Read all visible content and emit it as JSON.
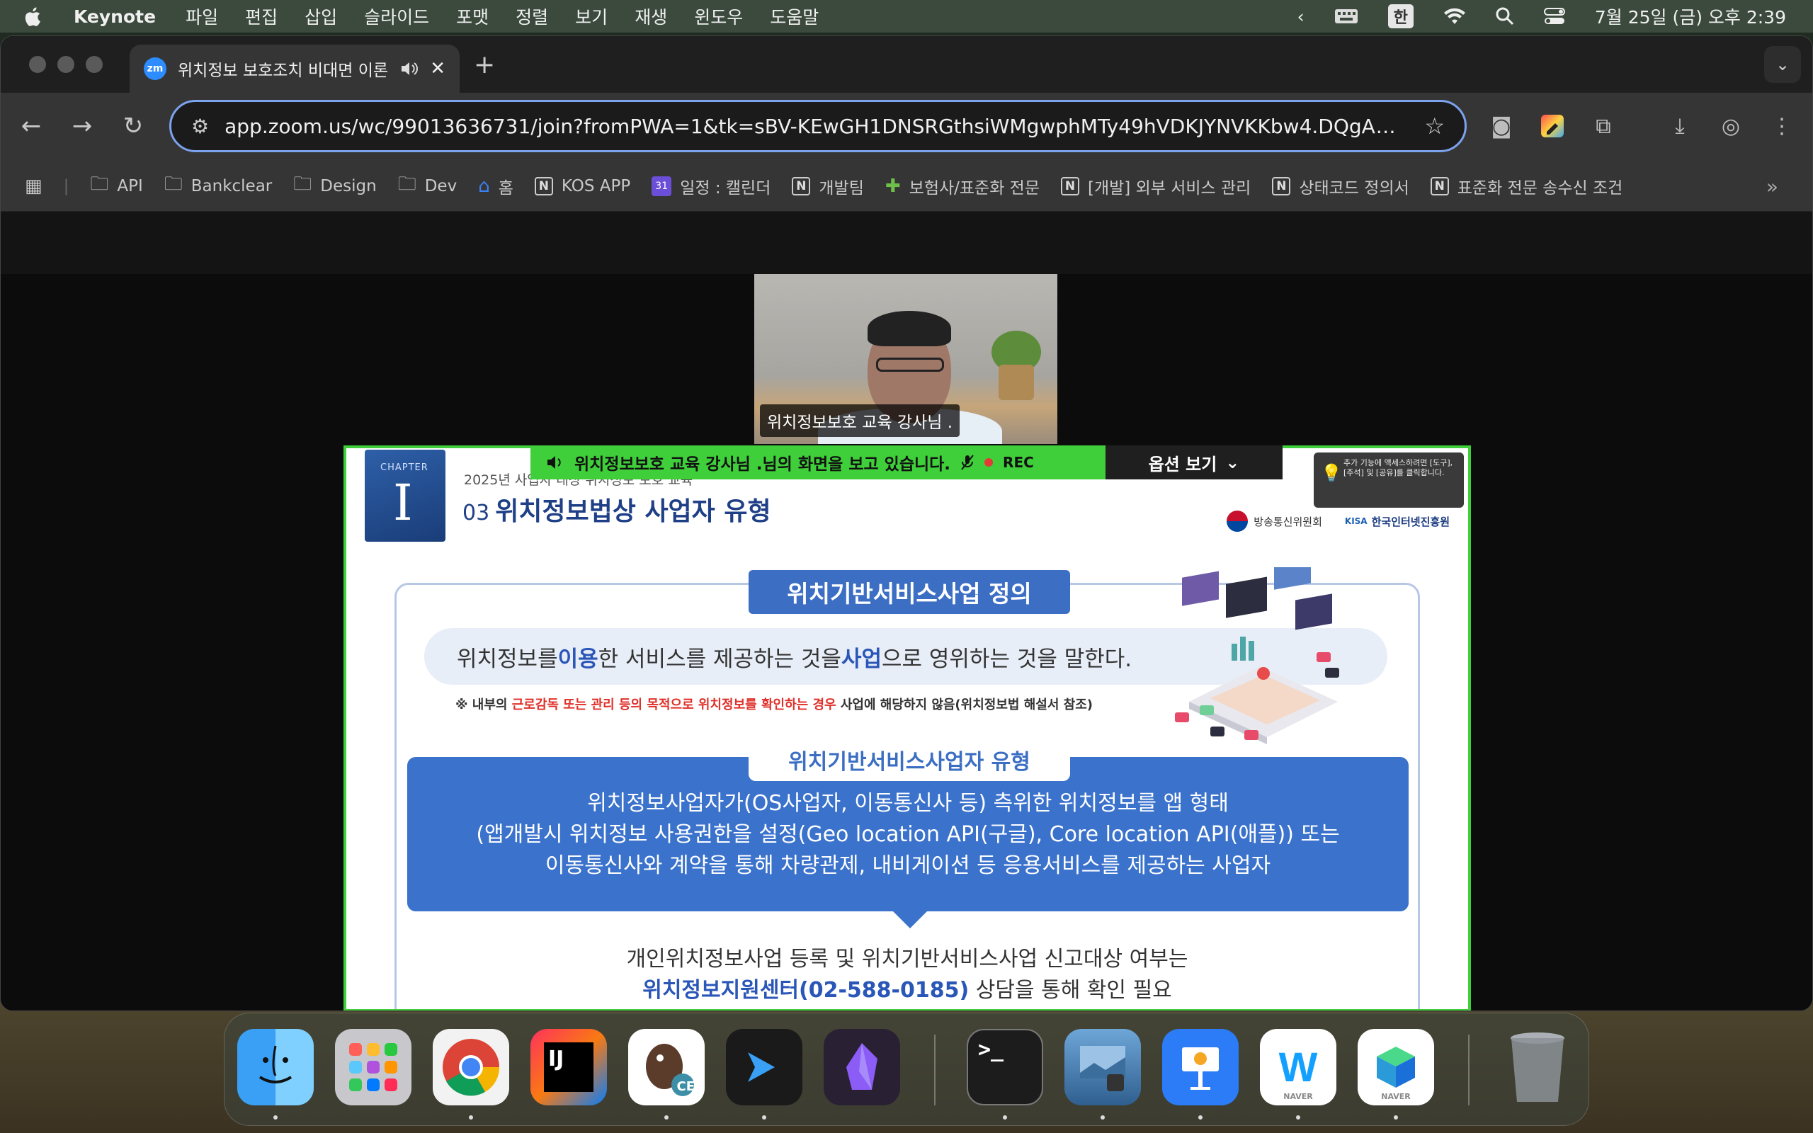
{
  "menubar": {
    "app_name": "Keynote",
    "menus": [
      "파일",
      "편집",
      "삽입",
      "슬라이드",
      "포맷",
      "정렬",
      "보기",
      "재생",
      "윈도우",
      "도움말"
    ],
    "input_source": "한",
    "datetime": "7월 25일 (금) 오후 2:39"
  },
  "browser": {
    "tab": {
      "favicon_text": "zm",
      "title": "위치정보 보호조치 비대면 이론"
    },
    "url": "app.zoom.us/wc/99013636731/join?fromPWA=1&tk=sBV-KEwGH1DNSRGthsiWMgwphMTy49hVDKJYNVKKbw4.DQgAAAAX...",
    "bookmarks": [
      "API",
      "Bankclear",
      "Design",
      "Dev",
      "홈",
      "KOS APP",
      "일정 : 캘린더",
      "개발팀",
      "보험사/표준화 전문",
      "[개발] 외부 서비스 관리",
      "상태코드 정의서",
      "표준화 전문 송수신 조건"
    ],
    "calendar_badge": "31"
  },
  "zoom": {
    "participant_name": "위치정보보호 교육 강사님 .",
    "share_banner": "위치정보보호 교육 강사님 .님의 화면을 보고 있습니다.",
    "rec_label": "REC",
    "options_label": "옵션 보기",
    "tip_text": "추가 기능에 액세스하려면 [도구], [주석] 및 [공유]를 클릭합니다."
  },
  "slide": {
    "chapter_label": "CHAPTER",
    "chapter_num": "I",
    "subtitle": "2025년 사업자 대상 위치정보 보호 교육",
    "title_no": "03",
    "title": "위치정보법상 사업자 유형",
    "logo_kcc": "방송통신위원회",
    "logo_kisa_mark": "KISA",
    "logo_kisa": "한국인터넷진흥원",
    "def_head": "위치기반서비스사업 정의",
    "def_parts": [
      "위치정보를 ",
      "이용",
      "한 서비스를 제공하는 것을 ",
      "사업",
      "으로 영위하는 것을 말한다."
    ],
    "note_parts": [
      "※  내부의 ",
      "근로감독 또는 관리 등의 목적으로 위치정보를 확인하는 경우",
      " 사업에 해당하지 않음(위치정보법 해설서 참조)"
    ],
    "type_head": "위치기반서비스사업자 유형",
    "type_lines": [
      "위치정보사업자가(OS사업자, 이동통신사 등) 측위한 위치정보를 앱 형태",
      "(앱개발시 위치정보 사용권한을 설정(Geo location API(구글), Core location API(애플)) 또는",
      "이동통신사와 계약을 통해 차량관제, 내비게이션 등 응용서비스를 제공하는 사업자"
    ],
    "consult_line1": "개인위치정보사업 등록 및 위치기반서비스사업 신고대상 여부는",
    "consult_blue": "위치정보지원센터(02-588-0185)",
    "consult_rest": " 상담을 통해 확인 필요"
  },
  "dock": {
    "apps": [
      "Finder",
      "Launchpad",
      "Chrome",
      "IntelliJ IDEA",
      "DBeaver CE",
      "Azure Data Studio",
      "Obsidian",
      "Terminal",
      "Preview",
      "Keynote",
      "Naver Whale",
      "Naver Works",
      "Trash"
    ],
    "intellij_text": "IJ",
    "dbeaver_badge": "CE",
    "whale_text": "W",
    "naver_label": "NAVER"
  }
}
